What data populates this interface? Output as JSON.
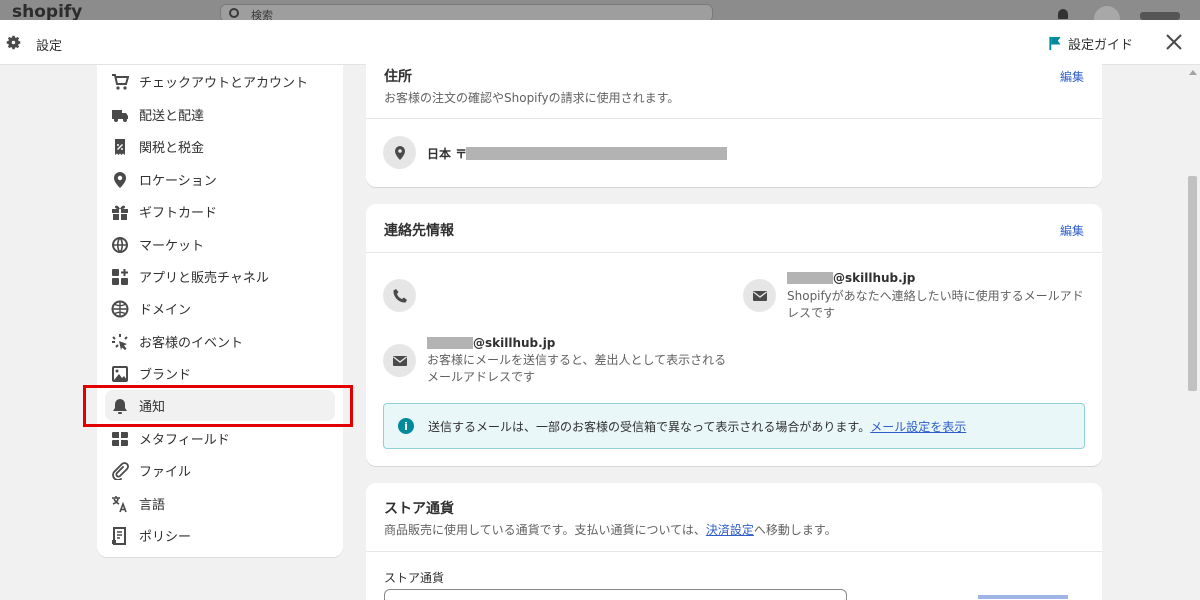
{
  "background": {
    "logo": "shopify",
    "search_placeholder": "検索"
  },
  "header": {
    "title": "設定",
    "guide_label": "設定ガイド",
    "icons": {
      "settings": "gear-icon",
      "guide": "flag-icon",
      "close": "close-icon"
    },
    "guide_flag_color": "#008a9c"
  },
  "sidebar": {
    "items": [
      {
        "label": "チェックアウトとアカウント",
        "icon": "cart-icon"
      },
      {
        "label": "配送と配達",
        "icon": "truck-icon"
      },
      {
        "label": "関税と税金",
        "icon": "receipt-percent-icon"
      },
      {
        "label": "ロケーション",
        "icon": "location-pin-icon"
      },
      {
        "label": "ギフトカード",
        "icon": "gift-card-icon"
      },
      {
        "label": "マーケット",
        "icon": "globe-icon"
      },
      {
        "label": "アプリと販売チャネル",
        "icon": "apps-icon"
      },
      {
        "label": "ドメイン",
        "icon": "domain-globe-icon"
      },
      {
        "label": "お客様のイベント",
        "icon": "sparkle-cursor-icon"
      },
      {
        "label": "ブランド",
        "icon": "brand-image-icon"
      },
      {
        "label": "通知",
        "icon": "bell-icon",
        "active": true
      },
      {
        "label": "メタフィールド",
        "icon": "metafields-icon"
      },
      {
        "label": "ファイル",
        "icon": "paperclip-icon"
      },
      {
        "label": "言語",
        "icon": "translate-icon"
      },
      {
        "label": "ポリシー",
        "icon": "policy-document-icon"
      }
    ],
    "highlight_color": "#e00000"
  },
  "address_card": {
    "title": "住所",
    "subtitle": "お客様の注文の確認やShopifyの請求に使用されます。",
    "edit_label": "編集",
    "country": "日本 〒"
  },
  "contact_card": {
    "title": "連絡先情報",
    "edit_label": "編集",
    "store_email_domain": "@skillhub.jp",
    "store_email_desc_line1": "Shopifyがあなたへ連絡したい時に使用するメールアド",
    "store_email_desc_line2": "レスです",
    "sender_email_domain": "@skillhub.jp",
    "sender_email_desc_line1": "お客様にメールを送信すると、差出人として表示される",
    "sender_email_desc_line2": "メールアドレスです",
    "banner_text": "送信するメールは、一部のお客様の受信箱で異なって表示される場合があります。",
    "banner_link": "メール設定を表示"
  },
  "currency_card": {
    "title": "ストア通貨",
    "subtitle_prefix": "商品販売に使用している通貨です。支払い通貨については、",
    "subtitle_link": "決済設定",
    "subtitle_suffix": "へ移動します。",
    "field_label": "ストア通貨"
  },
  "colors": {
    "link": "#2f5ec8",
    "banner_bg": "#eaf7f9",
    "info": "#008a9c"
  }
}
